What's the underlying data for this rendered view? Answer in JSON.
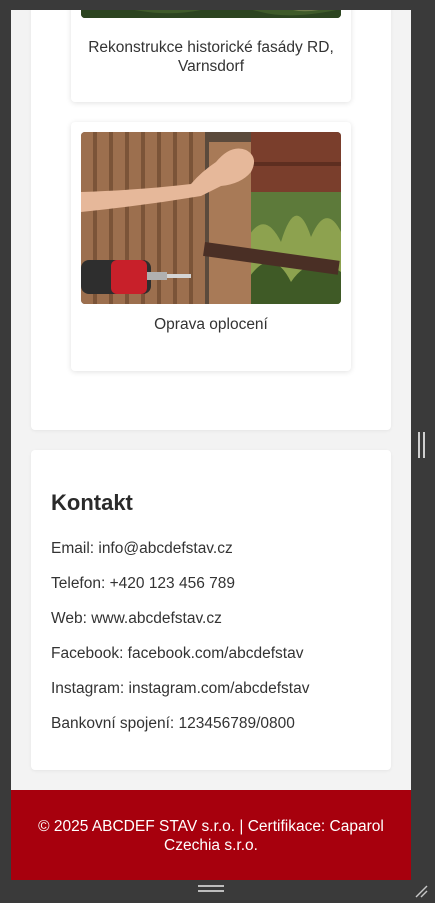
{
  "projects": [
    {
      "caption": "Rekonstrukce historické fasády RD, Varnsdorf",
      "image": "garden-hedge-photo"
    },
    {
      "caption": "Oprava oplocení",
      "image": "fence-repair-photo"
    }
  ],
  "contact": {
    "title": "Kontakt",
    "lines": [
      "Email: info@abcdefstav.cz",
      "Telefon: +420 123 456 789",
      "Web: www.abcdefstav.cz",
      "Facebook: facebook.com/abcdefstav",
      "Instagram: instagram.com/abcdefstav",
      "Bankovní spojení: 123456789/0800"
    ]
  },
  "footer": {
    "text": "© 2025 ABCDEF STAV s.r.o. | Certifikace: Caparol Czechia s.r.o."
  },
  "colors": {
    "accent": "#a7000d",
    "page_bg": "#f3f3f3",
    "frame": "#3a3a3a"
  },
  "icons": [
    "scroll-handle-icon",
    "drag-grip-icon",
    "resize-grip-icon"
  ]
}
